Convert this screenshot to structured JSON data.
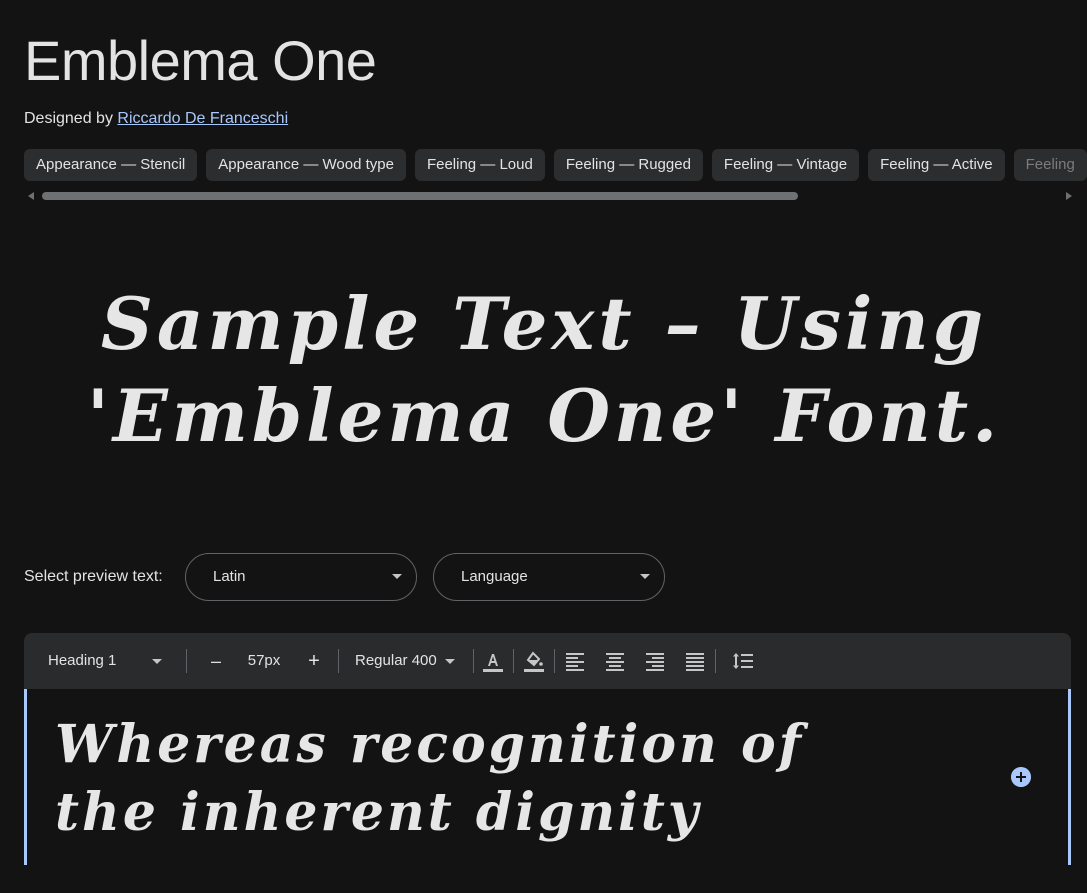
{
  "font": {
    "name": "Emblema One",
    "designed_by_prefix": "Designed by",
    "designer": "Riccardo De Franceschi"
  },
  "tags": [
    "Appearance — Stencil",
    "Appearance — Wood type",
    "Feeling — Loud",
    "Feeling — Rugged",
    "Feeling — Vintage",
    "Feeling — Active",
    "Feeling"
  ],
  "sample": {
    "line1": "Sample Text – Using",
    "line2": "'Emblema One' Font."
  },
  "preview": {
    "label": "Select preview text:",
    "script": "Latin",
    "language": "Language"
  },
  "toolbar": {
    "style": "Heading 1",
    "decrease": "–",
    "size": "57px",
    "increase": "+",
    "weight": "Regular 400"
  },
  "editor": {
    "line1": "Whereas recognition of",
    "line2": "the inherent dignity"
  },
  "colors": {
    "background": "#131314",
    "accent": "#a8c7fa",
    "chip": "#2c2d2e",
    "toolbar": "#2a2b2c"
  }
}
